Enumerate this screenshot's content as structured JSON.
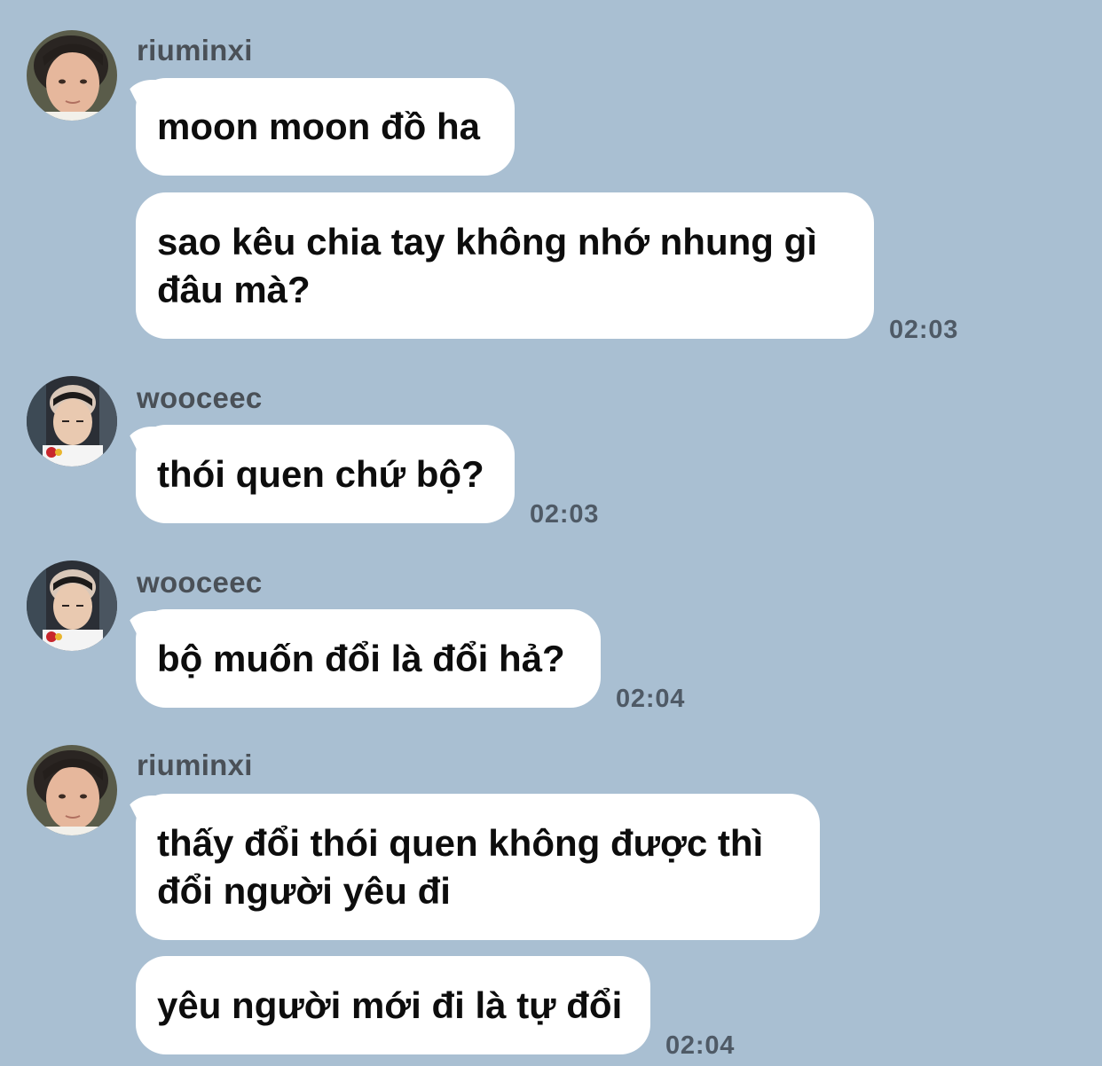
{
  "messages": [
    {
      "sender": "riuminxi",
      "text": "moon moon đồ ha"
    },
    {
      "text": "sao kêu chia tay không nhớ nhung gì\nđâu mà?",
      "time": "02:03"
    },
    {
      "sender": "wooceec",
      "text": "thói quen chứ bộ?",
      "time": "02:03"
    },
    {
      "sender": "wooceec",
      "text": "bộ muốn đổi là đổi hả?",
      "time": "02:04"
    },
    {
      "sender": "riuminxi",
      "text": "thấy đổi thói quen không được thì\nđổi người yêu đi"
    },
    {
      "text": "yêu người mới đi là tự đổi",
      "time": "02:04"
    }
  ],
  "colors": {
    "background": "#a9bfd2",
    "bubble": "#ffffff",
    "text": "#0d0d0d",
    "sender": "#4a5057",
    "timestamp": "#4f5a66"
  }
}
